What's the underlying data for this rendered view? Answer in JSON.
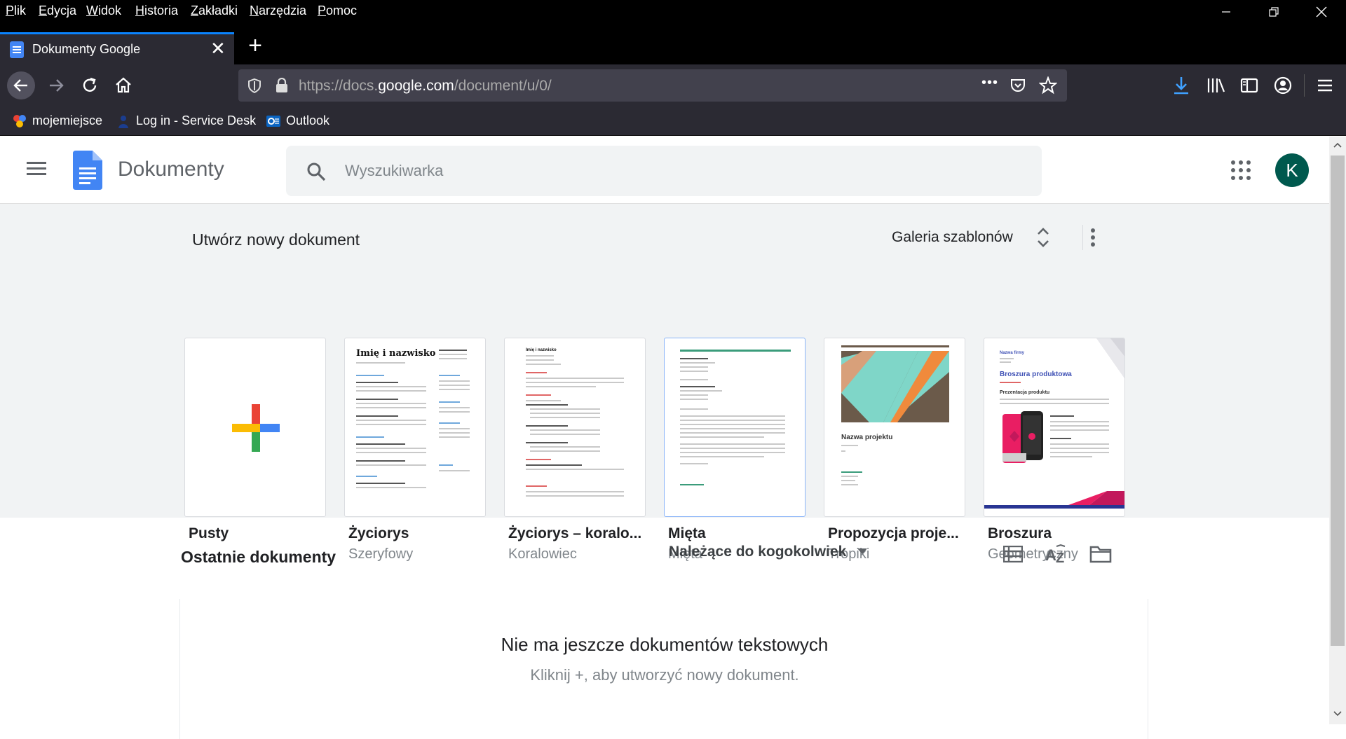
{
  "menubar": {
    "items": [
      "Plik",
      "Edycja",
      "Widok",
      "Historia",
      "Zakładki",
      "Narzędzia",
      "Pomoc"
    ]
  },
  "tab": {
    "title": "Dokumenty Google",
    "close": "✕",
    "new_tab": "+"
  },
  "urlbar": {
    "prefix": "https://docs.",
    "domain": "google.com",
    "path": "/document/u/0/",
    "more": "•••"
  },
  "bookmarks": [
    {
      "label": "mojemiejsce"
    },
    {
      "label": "Log in - Service Desk"
    },
    {
      "label": "Outlook"
    }
  ],
  "app": {
    "title": "Dokumenty",
    "search_placeholder": "Wyszukiwarka",
    "avatar_letter": "K"
  },
  "templates": {
    "title": "Utwórz nowy dokument",
    "gallery_label": "Galeria szablonów",
    "items": [
      {
        "name": "Pusty",
        "sub": ""
      },
      {
        "name": "Życiorys",
        "sub": "Szeryfowy"
      },
      {
        "name": "Życiorys – koralo...",
        "sub": "Koralowiec"
      },
      {
        "name": "Mięta",
        "sub": "Mięta"
      },
      {
        "name": "Propozycja proje...",
        "sub": "Tropiki"
      },
      {
        "name": "Broszura",
        "sub": "Geometryczny"
      }
    ],
    "thumb_texts": {
      "resume_name": "Imię i nazwisko",
      "coral_name": "Imię i nazwisko",
      "project_name": "Nazwa projektu",
      "brochure_company": "Nazwa firmy",
      "brochure_title": "Broszura produktowa",
      "brochure_sub": "Prezentacja produktu"
    }
  },
  "recent": {
    "title": "Ostatnie dokumenty",
    "owner_filter": "Należące do kogokolwiek",
    "empty_title": "Nie ma jeszcze dokumentów tekstowych",
    "empty_sub": "Kliknij +, aby utworzyć nowy dokument."
  },
  "colors": {
    "accent_blue": "#4285f4",
    "avatar": "#00594e",
    "tab_highlight": "#0a84ff"
  }
}
